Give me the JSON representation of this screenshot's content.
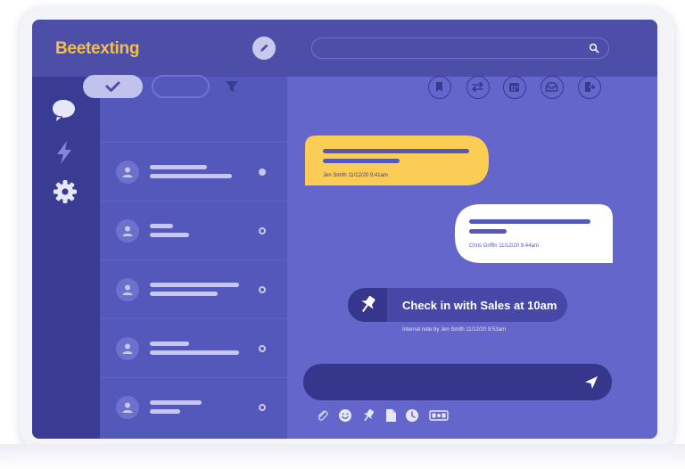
{
  "app": {
    "name": "Beetexting"
  },
  "search": {
    "placeholder": ""
  },
  "colors": {
    "accent": "#f4c04a",
    "topbar": "#4d4ea8",
    "rail": "#3a3b93",
    "conversations": "#5558bb",
    "chat": "#6466cc",
    "incoming_bubble": "#fbcd55",
    "outgoing_bubble": "#ffffff"
  },
  "sidebar": {
    "items": [
      {
        "icon": "chat-bubbles-icon"
      },
      {
        "icon": "lightning-icon"
      },
      {
        "icon": "gear-icon"
      }
    ]
  },
  "conversation_filters": [
    {
      "icon": "checkmark-icon",
      "selected": true
    },
    {
      "icon": "",
      "selected": false
    }
  ],
  "conversations": [
    {
      "unread": true
    },
    {
      "unread": false
    },
    {
      "unread": false
    },
    {
      "unread": false
    },
    {
      "unread": false
    }
  ],
  "chat_toolbar": [
    {
      "icon": "bookmark-icon"
    },
    {
      "icon": "transfer-arrows-icon"
    },
    {
      "icon": "calendar-icon"
    },
    {
      "icon": "inbox-icon"
    },
    {
      "icon": "export-icon"
    }
  ],
  "messages": [
    {
      "direction": "incoming",
      "meta": "Jen Smith   11/12/20 9:41am"
    },
    {
      "direction": "outgoing",
      "meta": "Chris Griffin   11/12/20 9:44am"
    }
  ],
  "note": {
    "text": "Check in with Sales at 10am",
    "meta": "Internal note by Jen Smith   11/12/20 9:53am"
  },
  "composer": {
    "attachments": [
      {
        "icon": "paperclip-icon"
      },
      {
        "icon": "emoji-icon"
      },
      {
        "icon": "pin-icon"
      },
      {
        "icon": "document-icon"
      },
      {
        "icon": "clock-icon"
      },
      {
        "icon": "payment-icon"
      }
    ]
  }
}
